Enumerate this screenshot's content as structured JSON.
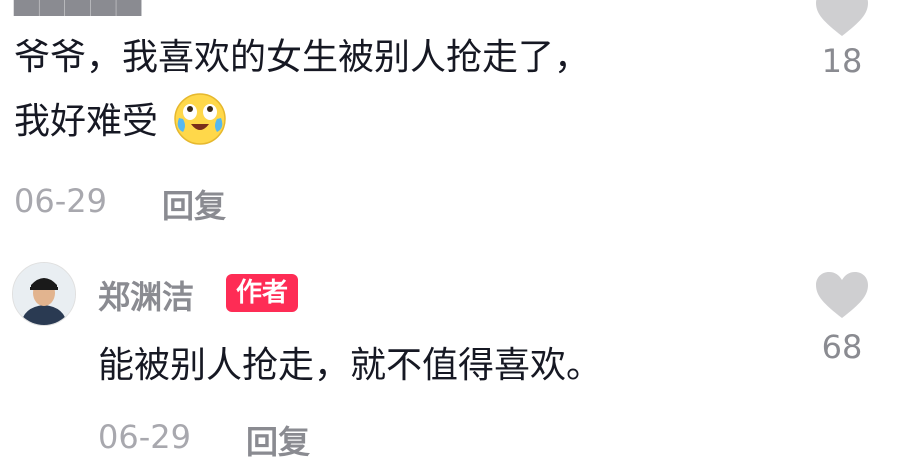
{
  "comment1": {
    "line1": "爷爷，我喜欢的女生被别人抢走了，",
    "line2": "我好难受",
    "emoji_icon": "crying-laughing-face",
    "date": "06-29",
    "reply_label": "回复",
    "likes": "18"
  },
  "reply1": {
    "author": "郑渊洁",
    "badge": "作者",
    "text": "能被别人抢走，就不值得喜欢。",
    "date": "06-29",
    "reply_label": "回复",
    "likes": "68"
  },
  "colors": {
    "badge_bg": "#fe2c55",
    "heart": "#cfcfd1",
    "meta_text": "#a8a8ae",
    "name_text": "#8a8b91"
  }
}
